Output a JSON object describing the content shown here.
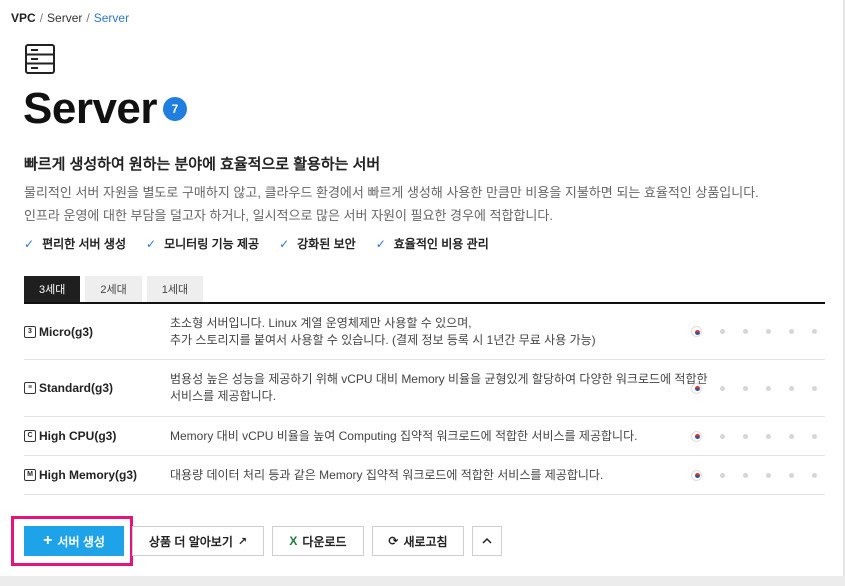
{
  "breadcrumb": {
    "root": "VPC",
    "sep": "/",
    "parent": "Server",
    "current": "Server"
  },
  "header": {
    "icon": "server-icon",
    "title": "Server",
    "badge": "7",
    "subtitle": "빠르게 생성하여 원하는 분야에 효율적으로 활용하는 서버",
    "desc_line1": "물리적인 서버 자원을 별도로 구매하지 않고, 클라우드 환경에서 빠르게 생성해 사용한 만큼만 비용을 지불하면 되는 효율적인 상품입니다.",
    "desc_line2": "인프라 운영에 대한 부담을 덜고자 하거나, 일시적으로 많은 서버 자원이 필요한 경우에 적합합니다."
  },
  "features": [
    "편리한 서버 생성",
    "모니터링 기능 제공",
    "강화된 보안",
    "효율적인 비용 관리"
  ],
  "tabs": [
    {
      "label": "3세대",
      "active": true
    },
    {
      "label": "2세대",
      "active": false
    },
    {
      "label": "1세대",
      "active": false
    }
  ],
  "server_types": [
    {
      "name": "Micro(g3)",
      "icon": "micro-server-icon",
      "desc1": "초소형 서버입니다. Linux 계열 운영체제만 사용할 수 있으며,",
      "desc2": "추가 스토리지를 붙여서 사용할 수 있습니다. (결제 정보 등록 시 1년간 무료 사용 가능)",
      "region_flag": "korea-flag-icon"
    },
    {
      "name": "Standard(g3)",
      "icon": "standard-server-icon",
      "desc1": "범용성 높은 성능을 제공하기 위해 vCPU 대비 Memory 비율을 균형있게 할당하여 다양한 워크로드에 적합한",
      "desc2": "서비스를 제공합니다.",
      "region_flag": "korea-flag-icon"
    },
    {
      "name": "High CPU(g3)",
      "icon": "high-cpu-server-icon",
      "desc1": "Memory 대비 vCPU 비율을 높여 Computing 집약적 워크로드에 적합한 서비스를 제공합니다.",
      "desc2": "",
      "region_flag": "korea-flag-icon"
    },
    {
      "name": "High Memory(g3)",
      "icon": "high-memory-server-icon",
      "desc1": "대용량 데이터 처리 등과 같은 Memory 집약적 워크로드에 적합한 서비스를 제공합니다.",
      "desc2": "",
      "region_flag": "korea-flag-icon"
    }
  ],
  "actions": {
    "create": "서버 생성",
    "learn_more": "상품 더 알아보기",
    "download": "다운로드",
    "refresh": "새로고침"
  },
  "colors": {
    "accent": "#1ea3e8",
    "highlight": "#e3157c",
    "link": "#2b78d0"
  }
}
